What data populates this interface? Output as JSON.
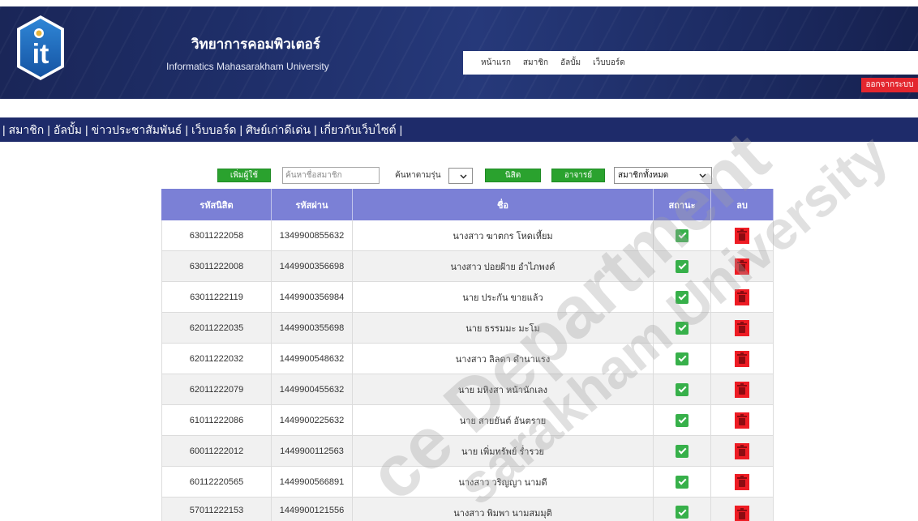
{
  "header": {
    "logo_text": "it",
    "title": "วิทยาการคอมพิวเตอร์",
    "subtitle": "Informatics Mahasarakham University",
    "nav": [
      "หน้าแรก",
      "สมาชิก",
      "อัลบั้ม",
      "เว็บบอร์ด"
    ],
    "logout_label": "ออกจากระบบ"
  },
  "menubar": {
    "separator": "|",
    "items": [
      "สมาชิก",
      "อัลบั้ม",
      "ข่าวประชาสัมพันธ์",
      "เว็บบอร์ด",
      "ศิษย์เก่าดีเด่น",
      "เกี่ยวกับเว็บไซต์"
    ]
  },
  "toolbar": {
    "add_user_label": "เพิ่มผู้ใช้",
    "search_placeholder": "ค้นหาชื่อสมาชิก",
    "generation_label": "ค้นหาตามรุ่น",
    "student_label": "นิสิต",
    "teacher_label": "อาจารย์",
    "member_filter_selected": "สมาชิกทั้งหมด"
  },
  "table": {
    "columns": [
      "รหัสนิสิต",
      "รหัสผ่าน",
      "ชื่อ",
      "สถานะ",
      "ลบ"
    ],
    "rows": [
      {
        "student_id": "63011222058",
        "password": "1349900855632",
        "name": "นางสาว ฆาตกร โหดเหี้ยม",
        "status": true
      },
      {
        "student_id": "63011222008",
        "password": "1449900356698",
        "name": "นางสาว ปอยฝ้าย อำไภพงค์",
        "status": true
      },
      {
        "student_id": "63011222119",
        "password": "1449900356984",
        "name": "นาย ประกัน ขายแล้ว",
        "status": true
      },
      {
        "student_id": "62011222035",
        "password": "1449900355698",
        "name": "นาย ธรรมมะ มะโม",
        "status": true
      },
      {
        "student_id": "62011222032",
        "password": "1449900548632",
        "name": "นางสาว ลิลดา ดำนาแรง",
        "status": true
      },
      {
        "student_id": "62011222079",
        "password": "1449900455632",
        "name": "นาย มหิงสา หน้านักเลง",
        "status": true
      },
      {
        "student_id": "61011222086",
        "password": "1449900225632",
        "name": "นาย สายยันต์ อันตราย",
        "status": true
      },
      {
        "student_id": "60011222012",
        "password": "1449900112563",
        "name": "นาย เพิ่มทรัพย์ ร่ำรวย",
        "status": true
      },
      {
        "student_id": "60112220565",
        "password": "1449900566891",
        "name": "นางสาว วริญญา นามดี",
        "status": true
      },
      {
        "student_id": "57011222153",
        "password": "1449900121556",
        "name": "นางสาว พิมพา นามสมมุติ",
        "status": true
      }
    ]
  },
  "watermark": {
    "line1": "ce Department",
    "line2": "sarakham University"
  },
  "icons": {
    "status": "checkbox-checked-icon",
    "delete": "trash-icon",
    "select": "chevron-down-icon"
  },
  "colors": {
    "header_bg": "#1f2f6a",
    "menubar_bg": "#1e2b6a",
    "table_header_bg": "#7b80d6",
    "button_green": "#2aa22e",
    "logout_red": "#e3262e",
    "delete_red": "#ee1c24",
    "status_green": "#37b04a"
  }
}
